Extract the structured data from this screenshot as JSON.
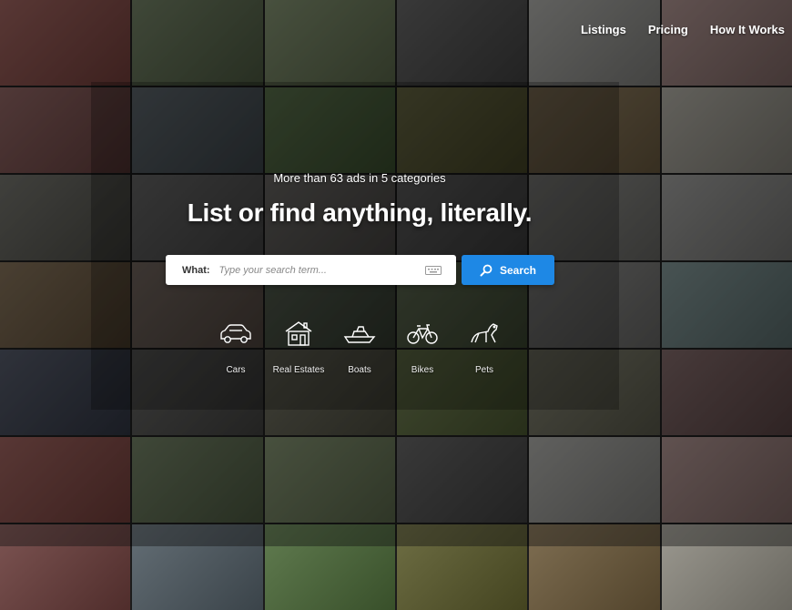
{
  "nav": {
    "items": [
      {
        "label": "Listings"
      },
      {
        "label": "Pricing"
      },
      {
        "label": "How It Works"
      }
    ]
  },
  "hero": {
    "subtitle": "More than 63 ads in 5 categories",
    "headline": "List or find anything, literally."
  },
  "search": {
    "label": "What:",
    "placeholder": "Type your search term...",
    "button_label": "Search",
    "accent": "#1e88e5"
  },
  "categories": [
    {
      "label": "Cars",
      "icon": "car-icon"
    },
    {
      "label": "Real Estates",
      "icon": "house-icon"
    },
    {
      "label": "Boats",
      "icon": "boat-icon"
    },
    {
      "label": "Bikes",
      "icon": "bicycle-icon"
    },
    {
      "label": "Pets",
      "icon": "dog-icon"
    }
  ]
}
